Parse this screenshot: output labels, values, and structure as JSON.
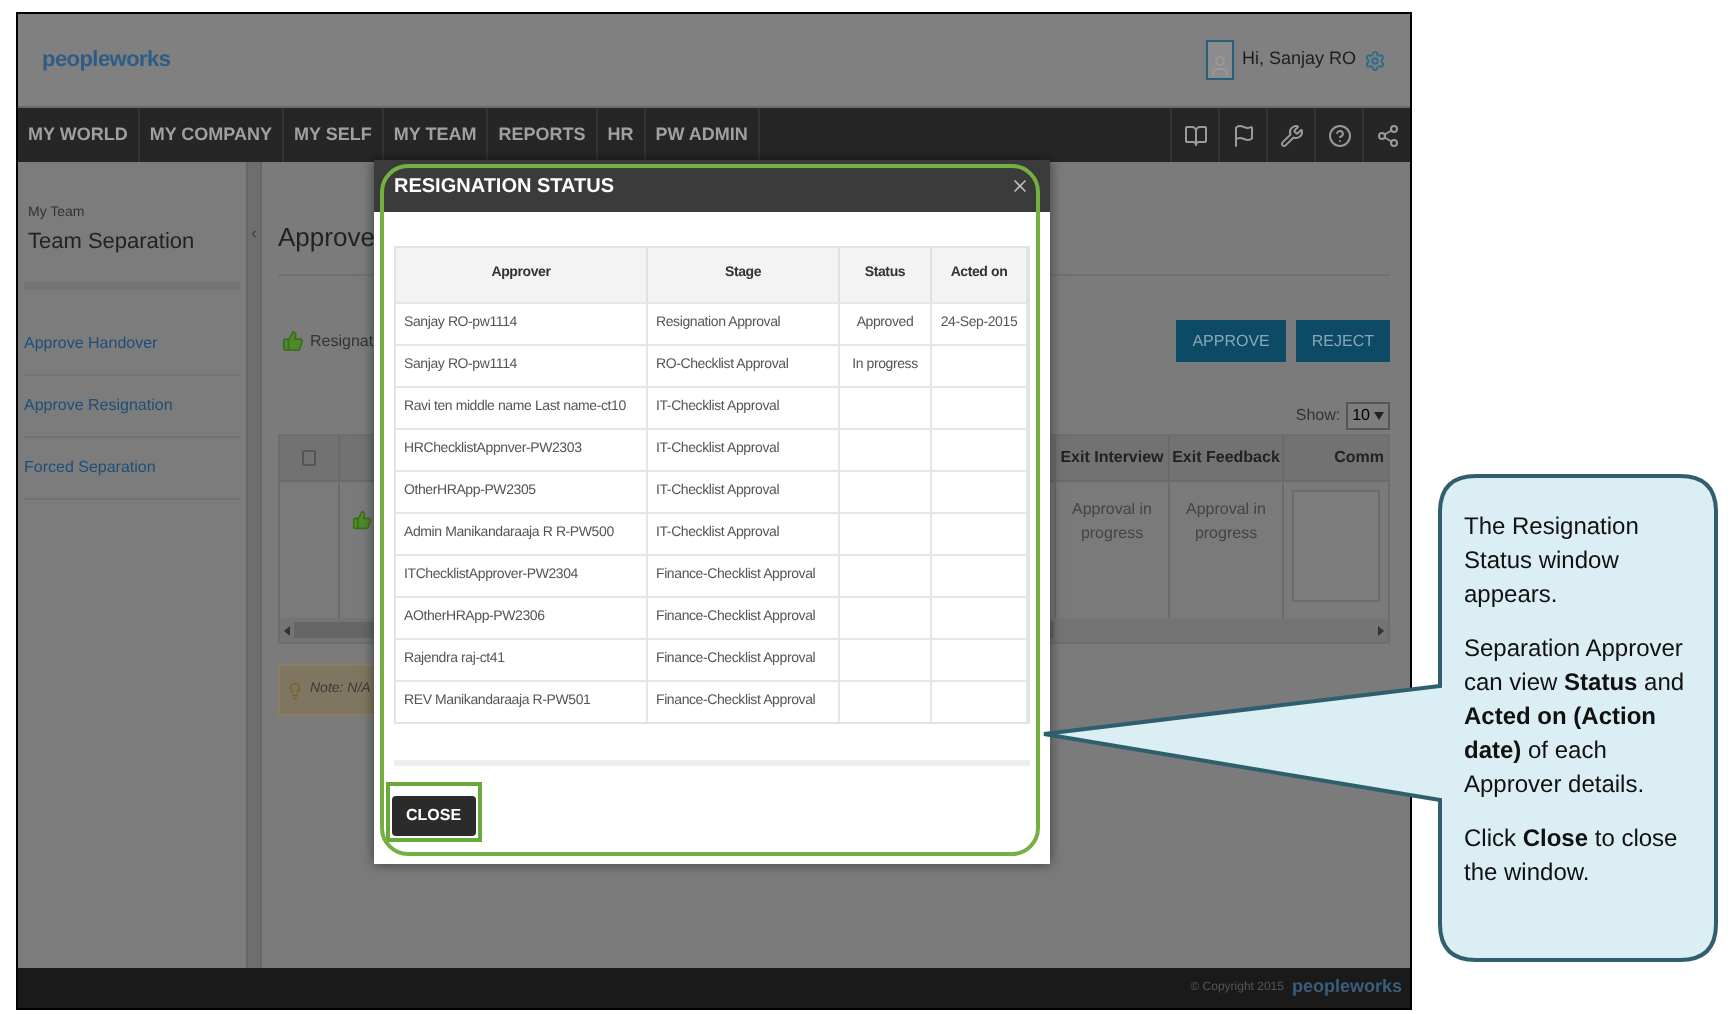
{
  "header": {
    "logo": "peopleworks",
    "greeting": "Hi, Sanjay RO"
  },
  "nav": [
    "MY WORLD",
    "MY COMPANY",
    "MY SELF",
    "MY TEAM",
    "REPORTS",
    "HR",
    "PW ADMIN"
  ],
  "sidebar": {
    "section": "My Team",
    "title": "Team Separation",
    "items": [
      "Approve Handover",
      "Approve Resignation",
      "Forced Separation"
    ]
  },
  "main": {
    "title": "Approve",
    "tab_label": "Resignat",
    "buttons": [
      "APPROVE",
      "REJECT"
    ],
    "show_label": "Show:",
    "show_value": "10",
    "columns": [
      "Exit Interview",
      "Exit Feedback",
      "Comm"
    ],
    "row": [
      "Approval in progress",
      "Approval in progress"
    ],
    "note": "Note: N/A",
    "select_all": {
      "checked": false
    }
  },
  "modal": {
    "title": "RESIGNATION STATUS",
    "columns": [
      "Approver",
      "Stage",
      "Status",
      "Acted on"
    ],
    "rows": [
      {
        "approver": "Sanjay RO-pw1114",
        "stage": "Resignation Approval",
        "status": "Approved",
        "acted_on": "24-Sep-2015"
      },
      {
        "approver": "Sanjay RO-pw1114",
        "stage": "RO-Checklist Approval",
        "status": "In progress"
      },
      {
        "approver": "Ravi ten middle name Last name-ct10",
        "stage": "IT-Checklist Approval"
      },
      {
        "approver": "HRChecklistAppnver-PW2303",
        "stage": "IT-Checklist Approval"
      },
      {
        "approver": "OtherHRApp-PW2305",
        "stage": "IT-Checklist Approval"
      },
      {
        "approver": "Admin Manikandaraaja R R-PW500",
        "stage": "IT-Checklist Approval"
      },
      {
        "approver": "ITChecklistApprover-PW2304",
        "stage": "Finance-Checklist Approval"
      },
      {
        "approver": "AOtherHRApp-PW2306",
        "stage": "Finance-Checklist Approval"
      },
      {
        "approver": "Rajendra raj-ct41",
        "stage": "Finance-Checklist Approval"
      },
      {
        "approver": "REV Manikandaraaja R-PW501",
        "stage": "Finance-Checklist Approval"
      }
    ],
    "close_button": "CLOSE"
  },
  "footer": {
    "copyright": "© Copyright 2015",
    "logo": "peopleworks"
  },
  "callout": [
    "The Resignation Status window appears.",
    "Separation Approver can view **Status** and **Acted on (Action date)** of each Approver details.",
    "Click **Close** to close the window."
  ]
}
